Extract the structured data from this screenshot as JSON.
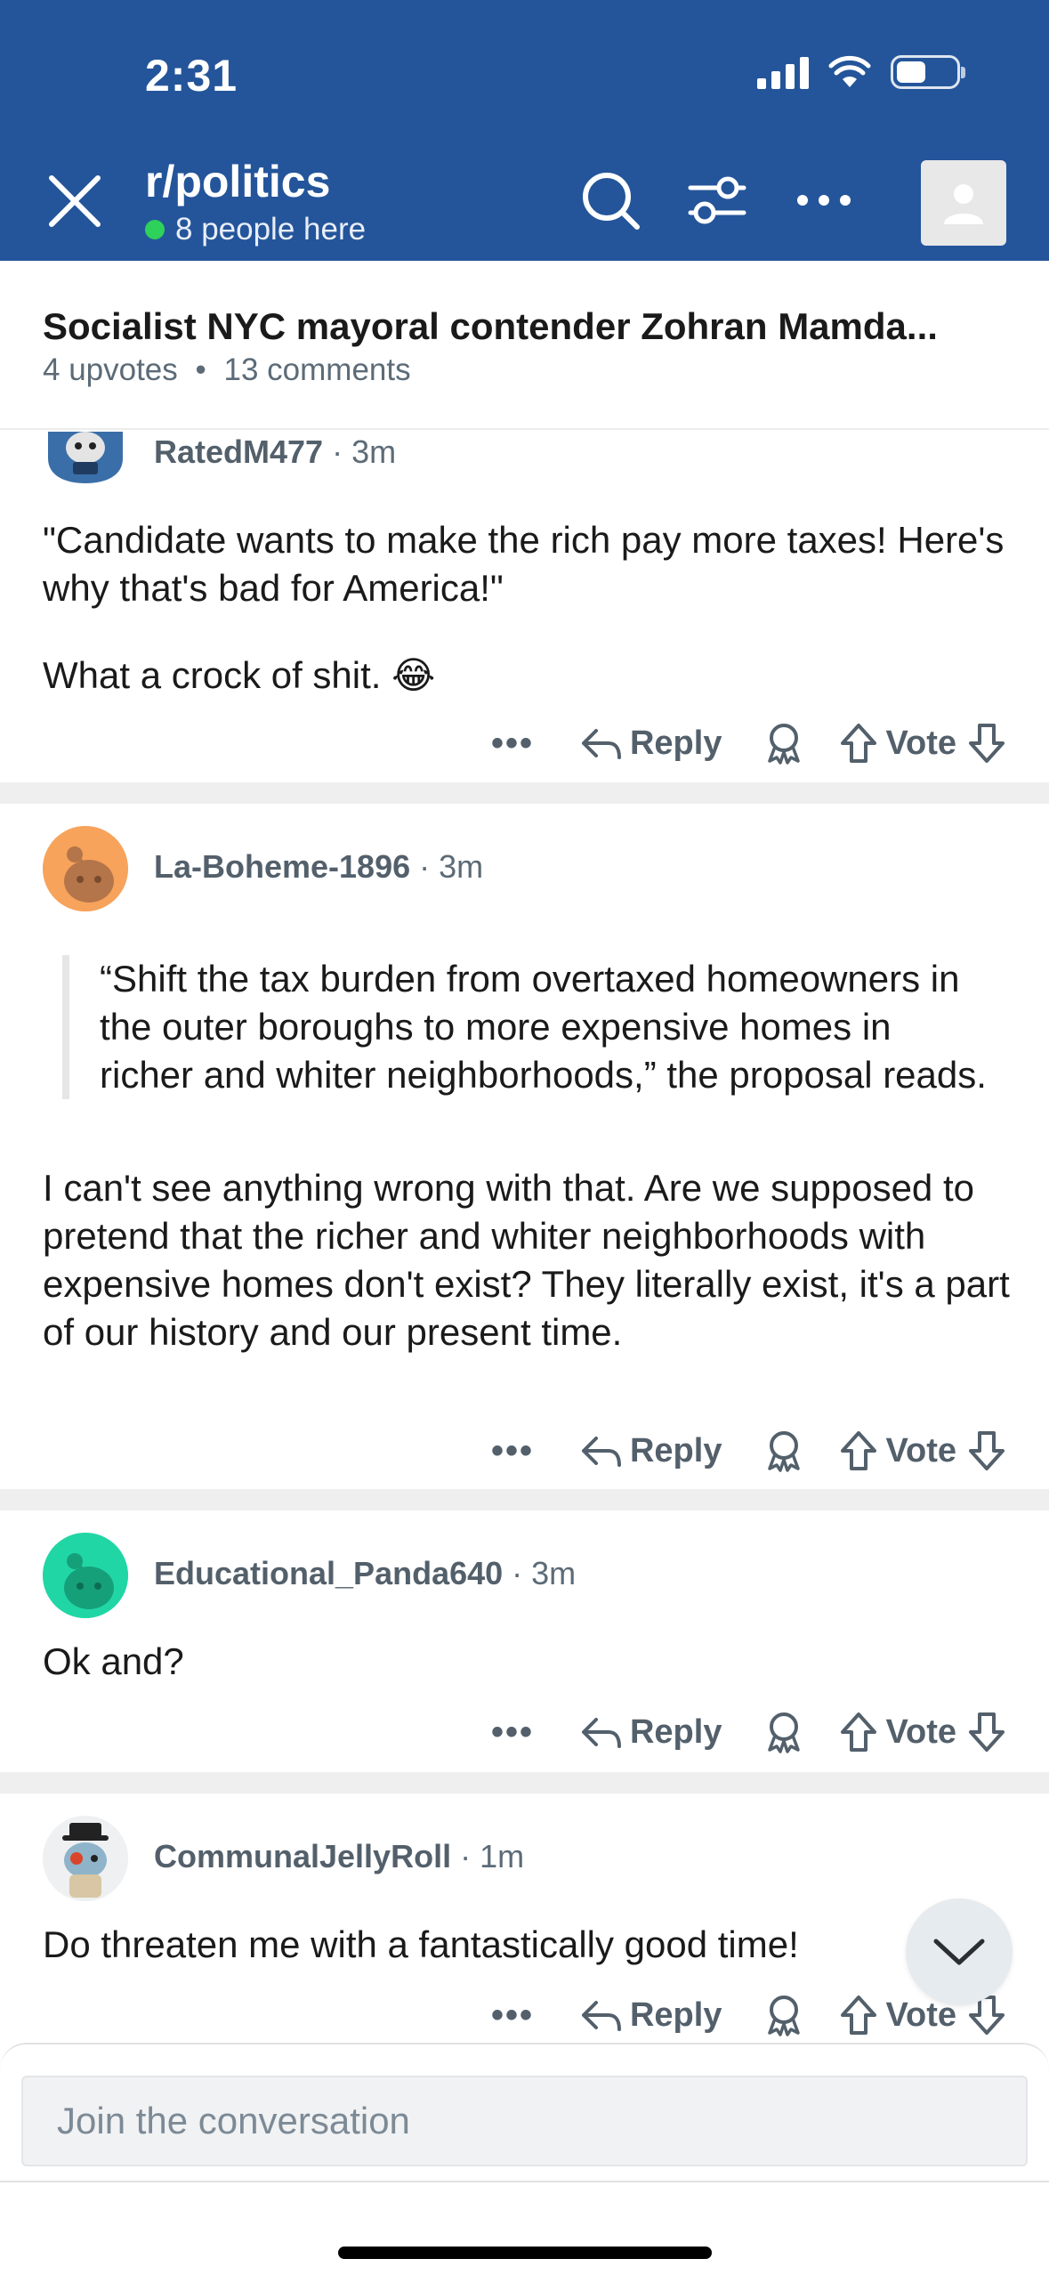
{
  "status_bar": {
    "time": "2:31"
  },
  "header": {
    "subreddit": "r/politics",
    "presence": "8 people here",
    "colors": {
      "background": "#24559a",
      "presence_dot": "#2ed15a"
    }
  },
  "post": {
    "title": "Socialist NYC mayoral contender Zohran Mamda...",
    "upvotes": "4 upvotes",
    "separator": "•",
    "comments": "13 comments"
  },
  "comment_actions": {
    "more": "•••",
    "reply": "Reply",
    "vote": "Vote"
  },
  "comments": [
    {
      "author": "RatedM477",
      "time": "3m",
      "paragraphs": [
        "\"Candidate wants to make the rich pay more taxes! Here's why that's bad for America!\"",
        "What a crock of shit. 😂"
      ]
    },
    {
      "author": "La-Boheme-1896",
      "time": "3m",
      "quote": "“Shift the tax burden from overtaxed homeowners in the outer boroughs to more expensive homes in richer and whiter neighborhoods,” the proposal reads.",
      "paragraphs": [
        "I can't see anything wrong with that. Are we supposed to pretend that the richer and whiter neighborhoods with expensive homes don't exist? They literally exist, it's a part of our history and our present time."
      ]
    },
    {
      "author": "Educational_Panda640",
      "time": "3m",
      "paragraphs": [
        "Ok and?"
      ]
    },
    {
      "author": "CommunalJellyRoll",
      "time": "1m",
      "paragraphs": [
        "Do threaten me with a fantastically good time!"
      ]
    }
  ],
  "composer": {
    "placeholder": "Join the conversation"
  }
}
